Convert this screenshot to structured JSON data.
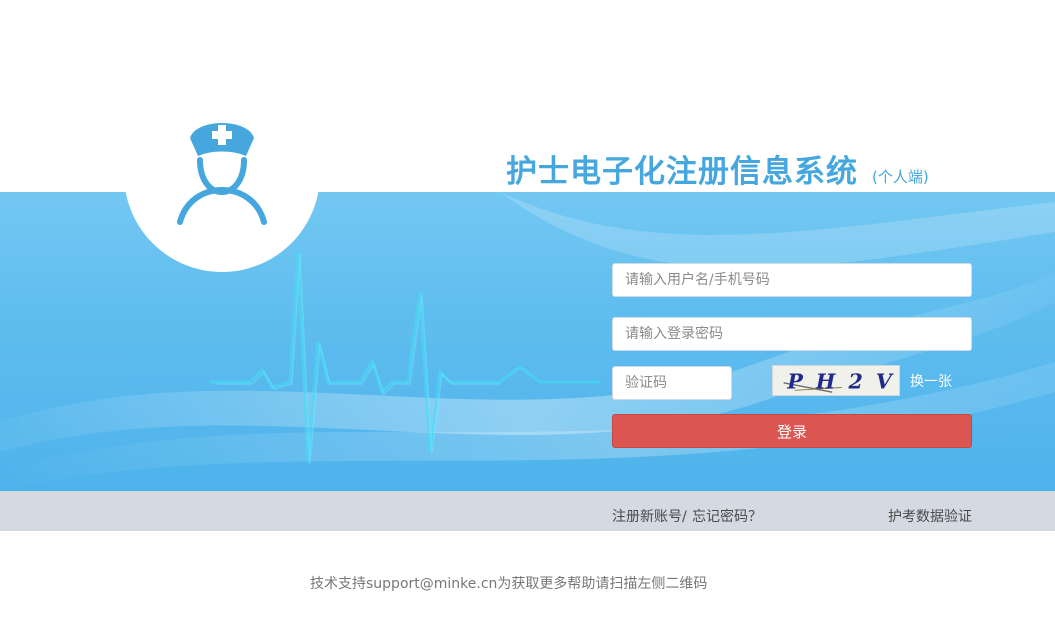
{
  "header": {
    "title": "护士电子化注册信息系统",
    "subtitle": "(个人端)"
  },
  "login": {
    "username_placeholder": "请输入用户名/手机号码",
    "password_placeholder": "请输入登录密码",
    "captcha_placeholder": "验证码",
    "captcha_text": "PH2V",
    "refresh_label": "换一张",
    "login_label": "登录"
  },
  "links": {
    "register": "注册新账号/",
    "forgot": "忘记密码？",
    "verify": "护考数据验证"
  },
  "footer": {
    "support": "技术支持support@minke.cn为获取更多帮助请扫描左侧二维码"
  },
  "colors": {
    "accent": "#45a7de",
    "banner": "#5ebcee",
    "login_button": "#dc5651",
    "links_bar": "#d4d9e2"
  }
}
